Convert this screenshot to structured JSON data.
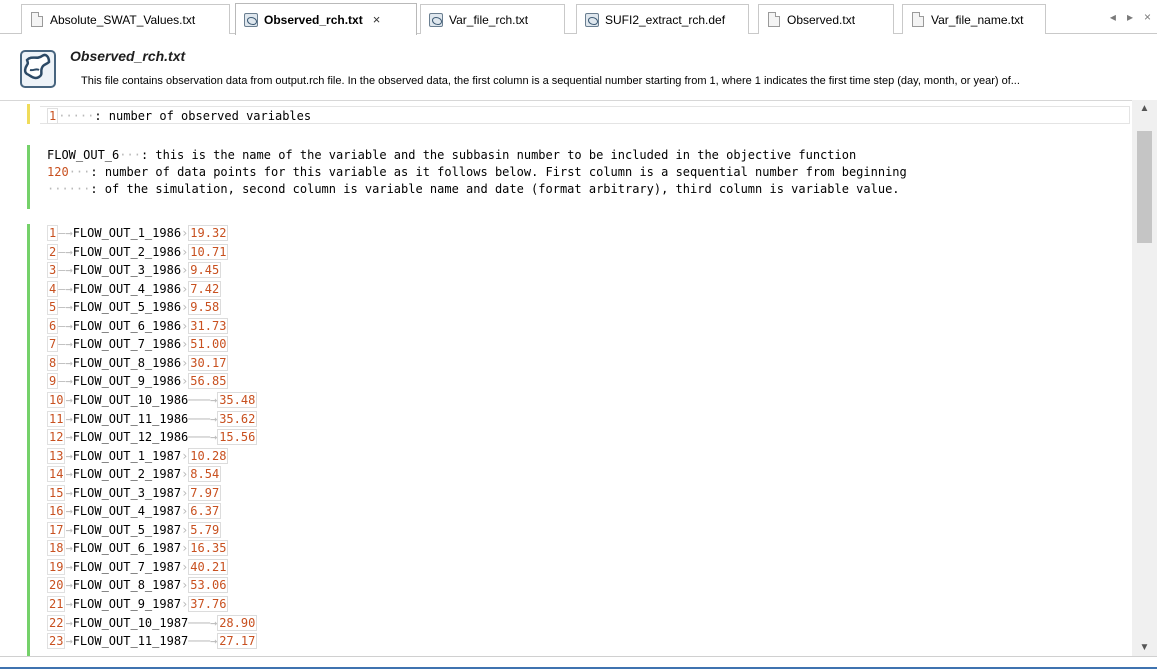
{
  "tabs": [
    {
      "label": "Absolute_SWAT_Values.txt",
      "icon": "document-icon",
      "active": false
    },
    {
      "label": "Observed_rch.txt",
      "icon": "swat-file-icon",
      "active": true,
      "close": "×"
    },
    {
      "label": "Var_file_rch.txt",
      "icon": "swat-file-icon",
      "active": false
    },
    {
      "label": "SUFI2_extract_rch.def",
      "icon": "swat-file-icon",
      "active": false
    },
    {
      "label": "Observed.txt",
      "icon": "document-icon",
      "active": false
    },
    {
      "label": "Var_file_name.txt",
      "icon": "document-icon",
      "active": false
    }
  ],
  "tab_nav": {
    "left": "◂",
    "right": "▸",
    "close": "×"
  },
  "description": {
    "title": "Observed_rch.txt",
    "text": "This file contains observation data from output.rch file. In the observed data, the first column is a sequential number starting from 1, where 1 indicates the first time step (day, month, or year) of..."
  },
  "editor": {
    "header_line": {
      "num": "1",
      "text": ": number of observed variables"
    },
    "block": [
      {
        "label": "FLOW_OUT_6",
        "text": ": this is the name of the variable and the subbasin number to be included in the objective function"
      },
      {
        "label": "120",
        "text": ": number of data points for this variable as it follows below. First column is a sequential number from beginning"
      },
      {
        "label": "",
        "text": ": of the simulation, second column is variable name and date (format arbitrary), third column is variable value."
      }
    ],
    "rows": [
      {
        "n": "1",
        "name": "FLOW_OUT_1_1986",
        "value": "19.32"
      },
      {
        "n": "2",
        "name": "FLOW_OUT_2_1986",
        "value": "10.71"
      },
      {
        "n": "3",
        "name": "FLOW_OUT_3_1986",
        "value": "9.45"
      },
      {
        "n": "4",
        "name": "FLOW_OUT_4_1986",
        "value": "7.42"
      },
      {
        "n": "5",
        "name": "FLOW_OUT_5_1986",
        "value": "9.58"
      },
      {
        "n": "6",
        "name": "FLOW_OUT_6_1986",
        "value": "31.73"
      },
      {
        "n": "7",
        "name": "FLOW_OUT_7_1986",
        "value": "51.00"
      },
      {
        "n": "8",
        "name": "FLOW_OUT_8_1986",
        "value": "30.17"
      },
      {
        "n": "9",
        "name": "FLOW_OUT_9_1986",
        "value": "56.85"
      },
      {
        "n": "10",
        "name": "FLOW_OUT_10_1986",
        "value": "35.48"
      },
      {
        "n": "11",
        "name": "FLOW_OUT_11_1986",
        "value": "35.62"
      },
      {
        "n": "12",
        "name": "FLOW_OUT_12_1986",
        "value": "15.56"
      },
      {
        "n": "13",
        "name": "FLOW_OUT_1_1987",
        "value": "10.28"
      },
      {
        "n": "14",
        "name": "FLOW_OUT_2_1987",
        "value": "8.54"
      },
      {
        "n": "15",
        "name": "FLOW_OUT_3_1987",
        "value": "7.97"
      },
      {
        "n": "16",
        "name": "FLOW_OUT_4_1987",
        "value": "6.37"
      },
      {
        "n": "17",
        "name": "FLOW_OUT_5_1987",
        "value": "5.79"
      },
      {
        "n": "18",
        "name": "FLOW_OUT_6_1987",
        "value": "16.35"
      },
      {
        "n": "19",
        "name": "FLOW_OUT_7_1987",
        "value": "40.21"
      },
      {
        "n": "20",
        "name": "FLOW_OUT_8_1987",
        "value": "53.06"
      },
      {
        "n": "21",
        "name": "FLOW_OUT_9_1987",
        "value": "37.76"
      },
      {
        "n": "22",
        "name": "FLOW_OUT_10_1987",
        "value": "28.90"
      },
      {
        "n": "23",
        "name": "FLOW_OUT_11_1987",
        "value": "27.17"
      }
    ]
  },
  "scrollbar": {
    "up": "▲",
    "down": "▼"
  }
}
